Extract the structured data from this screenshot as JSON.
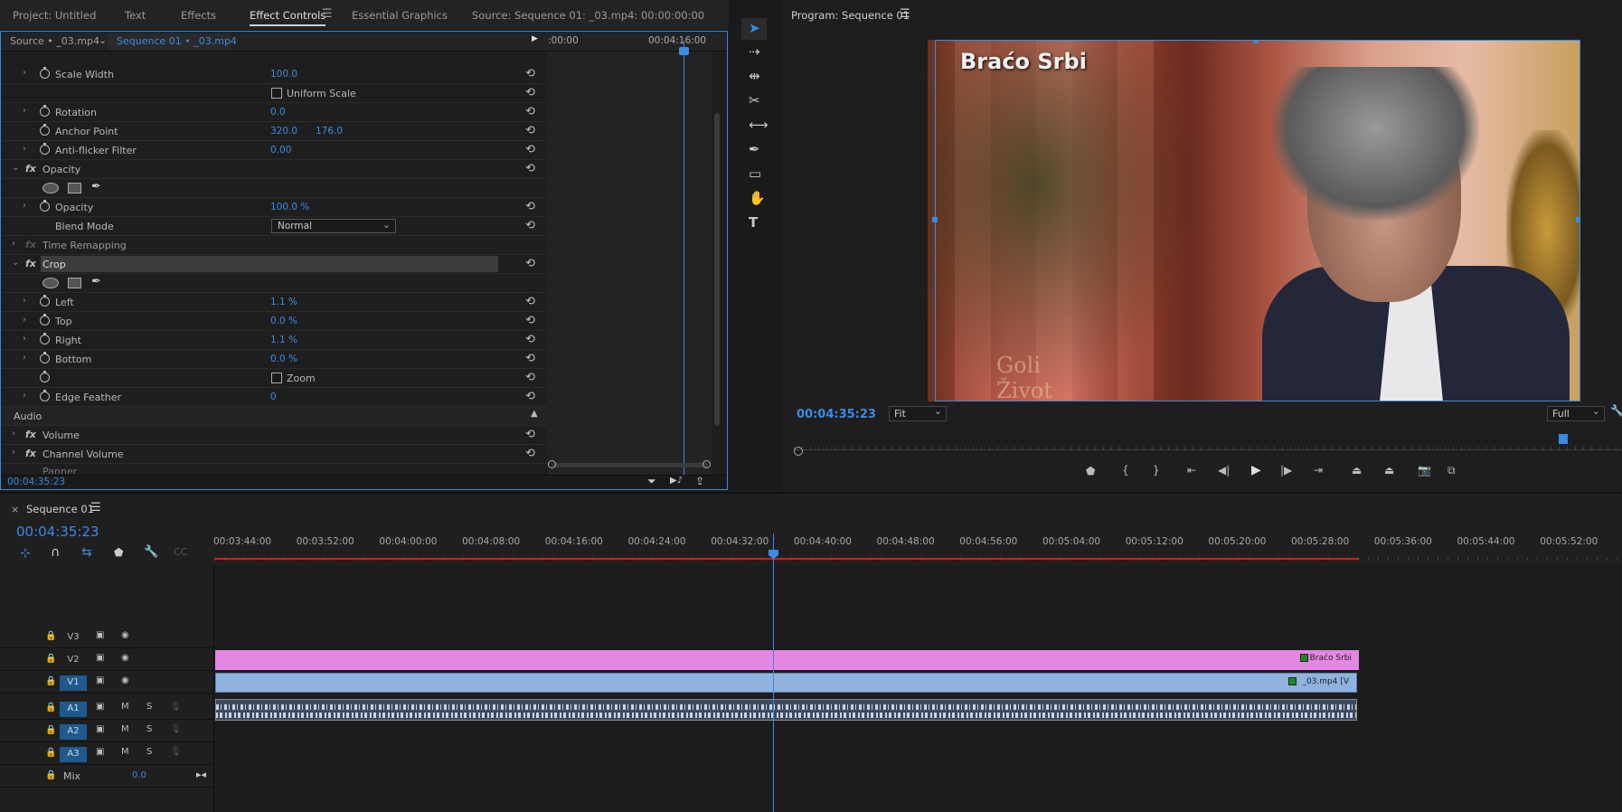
{
  "top_tabs": {
    "project": "Project: Untitled",
    "text": "Text",
    "effects": "Effects",
    "effect_controls": "Effect Controls",
    "essential_graphics": "Essential Graphics",
    "source": "Source: Sequence 01: _03.mp4: 00:00:00:00"
  },
  "effect_controls": {
    "source_label": "Source • _03.mp4",
    "sequence_label": "Sequence 01 • _03.mp4",
    "mini_timecode_start": ":00:00",
    "mini_timecode_end": "00:04:16:00",
    "rows": {
      "scale_width": {
        "label": "Scale Width",
        "value": "100.0"
      },
      "uniform_scale": {
        "label": "Uniform Scale"
      },
      "rotation": {
        "label": "Rotation",
        "value": "0.0"
      },
      "anchor_point": {
        "label": "Anchor Point",
        "value_x": "320.0",
        "value_y": "176.0"
      },
      "anti_flicker": {
        "label": "Anti-flicker Filter",
        "value": "0.00"
      },
      "opacity_section": {
        "label": "Opacity"
      },
      "opacity": {
        "label": "Opacity",
        "value": "100.0 %"
      },
      "blend_mode": {
        "label": "Blend Mode",
        "value": "Normal"
      },
      "time_remapping": {
        "label": "Time Remapping"
      },
      "crop_section": {
        "label": "Crop"
      },
      "left": {
        "label": "Left",
        "value": "1.1 %"
      },
      "top": {
        "label": "Top",
        "value": "0.0 %"
      },
      "right": {
        "label": "Right",
        "value": "1.1 %"
      },
      "bottom": {
        "label": "Bottom",
        "value": "0.0 %"
      },
      "zoom": {
        "label": "Zoom"
      },
      "edge_feather": {
        "label": "Edge Feather",
        "value": "0"
      },
      "audio_header": {
        "label": "Audio"
      },
      "volume": {
        "label": "Volume"
      },
      "channel_volume": {
        "label": "Channel Volume"
      },
      "panner": {
        "label": "Panner"
      }
    },
    "current_time": "00:04:35:23"
  },
  "program_monitor": {
    "title": "Program: Sequence 01",
    "timecode": "00:04:35:23",
    "fit": "Fit",
    "resolution": "Full",
    "video_overlay_text": "Braćo Srbi",
    "video_sign_text_1": "Goli",
    "video_sign_text_2": "Život"
  },
  "timeline": {
    "title": "Sequence 01",
    "timecode": "00:04:35:23",
    "ruler": [
      "00:03:44:00",
      "00:03:52:00",
      "00:04:00:00",
      "00:04:08:00",
      "00:04:16:00",
      "00:04:24:00",
      "00:04:32:00",
      "00:04:40:00",
      "00:04:48:00",
      "00:04:56:00",
      "00:05:04:00",
      "00:05:12:00",
      "00:05:20:00",
      "00:05:28:00",
      "00:05:36:00",
      "00:05:44:00",
      "00:05:52:00"
    ],
    "tracks": {
      "v3": "V3",
      "v2": "V2",
      "v1": "V1",
      "a1": "A1",
      "a2": "A2",
      "a3": "A3",
      "mix": "Mix",
      "mix_value": "0.0"
    },
    "mute": "M",
    "solo": "S",
    "clips": {
      "v2_clip": "Braćo Srbi",
      "v1_clip": "_03.mp4 [V"
    }
  }
}
